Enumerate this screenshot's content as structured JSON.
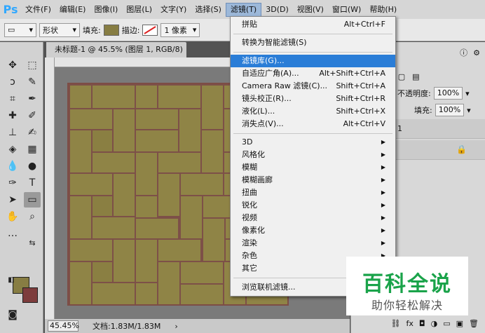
{
  "app": {
    "logo": "Ps"
  },
  "menubar": {
    "items": [
      "文件(F)",
      "编辑(E)",
      "图像(I)",
      "图层(L)",
      "文字(Y)",
      "选择(S)",
      "滤镜(T)",
      "3D(D)",
      "视图(V)",
      "窗口(W)",
      "帮助(H)"
    ],
    "active_index": 6
  },
  "options": {
    "mode": "形状",
    "fill_label": "填充:",
    "stroke_label": "描边:",
    "stroke_width": "1 像素",
    "fill_color": "#877d43"
  },
  "document": {
    "tab_title": "未标题-1 @ 45.5% (图层 1, RGB/8) *",
    "zoom": "45.45%",
    "doc_info": "文档:1.83M/1.83M"
  },
  "colors": {
    "foreground": "#877d43",
    "background": "#7d3c3c",
    "accent": "#2a7dd7"
  },
  "panels": {
    "opacity_label": "不透明度:",
    "opacity_value": "100%",
    "fill_label": "填充:",
    "fill_value": "100%",
    "layer_number": "1"
  },
  "filter_menu": {
    "items": [
      {
        "label": "拼贴",
        "shortcut": "Alt+Ctrl+F"
      },
      {
        "label": "转换为智能滤镜(S)",
        "shortcut": ""
      },
      {
        "label": "滤镜库(G)...",
        "shortcut": "",
        "highlighted": true
      },
      {
        "label": "自适应广角(A)...",
        "shortcut": "Alt+Shift+Ctrl+A"
      },
      {
        "label": "Camera Raw 滤镜(C)...",
        "shortcut": "Shift+Ctrl+A"
      },
      {
        "label": "镜头校正(R)...",
        "shortcut": "Shift+Ctrl+R"
      },
      {
        "label": "液化(L)...",
        "shortcut": "Shift+Ctrl+X"
      },
      {
        "label": "消失点(V)...",
        "shortcut": "Alt+Ctrl+V"
      },
      {
        "label": "3D",
        "submenu": true
      },
      {
        "label": "风格化",
        "submenu": true
      },
      {
        "label": "模糊",
        "submenu": true
      },
      {
        "label": "模糊画廊",
        "submenu": true
      },
      {
        "label": "扭曲",
        "submenu": true
      },
      {
        "label": "锐化",
        "submenu": true
      },
      {
        "label": "视频",
        "submenu": true
      },
      {
        "label": "像素化",
        "submenu": true
      },
      {
        "label": "渲染",
        "submenu": true
      },
      {
        "label": "杂色",
        "submenu": true
      },
      {
        "label": "其它",
        "submenu": true
      },
      {
        "label": "浏览联机滤镜...",
        "shortcut": ""
      }
    ]
  },
  "watermark": {
    "title": "百科全说",
    "subtitle": "助你轻松解决"
  }
}
